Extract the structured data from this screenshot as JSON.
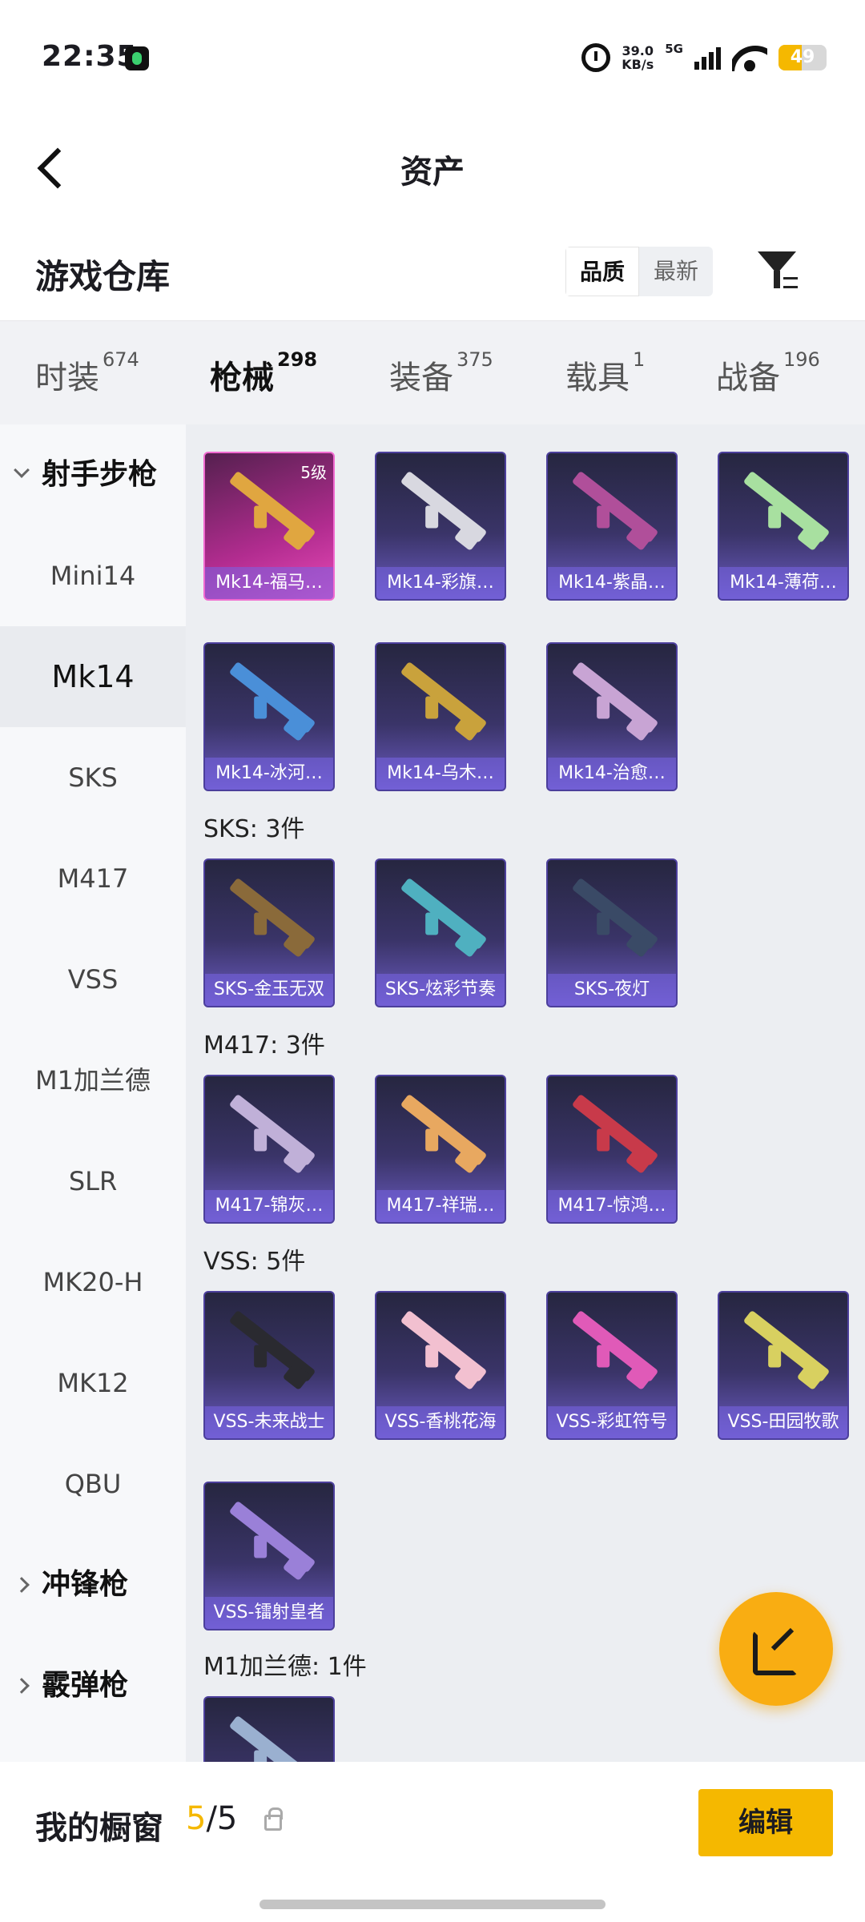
{
  "status_bar": {
    "time": "22:35",
    "speed_value": "39.0",
    "speed_unit": "KB/s",
    "network": "5G",
    "battery": "49"
  },
  "header": {
    "title": "资产"
  },
  "warehouse": {
    "title": "游戏仓库",
    "sort": [
      "品质",
      "最新"
    ]
  },
  "tabs": [
    {
      "label": "时装",
      "count": "674"
    },
    {
      "label": "枪械",
      "count": "298"
    },
    {
      "label": "装备",
      "count": "375"
    },
    {
      "label": "载具",
      "count": "1"
    },
    {
      "label": "战备",
      "count": "196"
    }
  ],
  "sidebar": [
    {
      "label": "射手步枪"
    },
    {
      "label": "Mini14"
    },
    {
      "label": "Mk14"
    },
    {
      "label": "SKS"
    },
    {
      "label": "M417"
    },
    {
      "label": "VSS"
    },
    {
      "label": "M1加兰德"
    },
    {
      "label": "SLR"
    },
    {
      "label": "MK20-H"
    },
    {
      "label": "MK12"
    },
    {
      "label": "QBU"
    },
    {
      "label": "冲锋枪"
    },
    {
      "label": "霰弹枪"
    }
  ],
  "sections": [
    {
      "title": "",
      "items": [
        {
          "name": "Mk14-福马…",
          "level": "5级"
        },
        {
          "name": "Mk14-彩旗…"
        },
        {
          "name": "Mk14-紫晶…"
        },
        {
          "name": "Mk14-薄荷…"
        },
        {
          "name": "Mk14-冰河…"
        },
        {
          "name": "Mk14-乌木…"
        },
        {
          "name": "Mk14-治愈…"
        }
      ]
    },
    {
      "title": "SKS: 3件",
      "items": [
        {
          "name": "SKS-金玉无双"
        },
        {
          "name": "SKS-炫彩节奏"
        },
        {
          "name": "SKS-夜灯"
        }
      ]
    },
    {
      "title": "M417: 3件",
      "items": [
        {
          "name": "M417-锦灰…"
        },
        {
          "name": "M417-祥瑞…"
        },
        {
          "name": "M417-惊鸿…"
        }
      ]
    },
    {
      "title": "VSS: 5件",
      "items": [
        {
          "name": "VSS-未来战士"
        },
        {
          "name": "VSS-香桃花海"
        },
        {
          "name": "VSS-彩虹符号"
        },
        {
          "name": "VSS-田园牧歌"
        },
        {
          "name": "VSS-镭射皇者"
        }
      ]
    },
    {
      "title": "M1加兰德: 1件",
      "items": []
    }
  ],
  "bottom": {
    "label": "我的橱窗",
    "count_current": "5",
    "count_total": "/5",
    "edit": "编辑"
  }
}
